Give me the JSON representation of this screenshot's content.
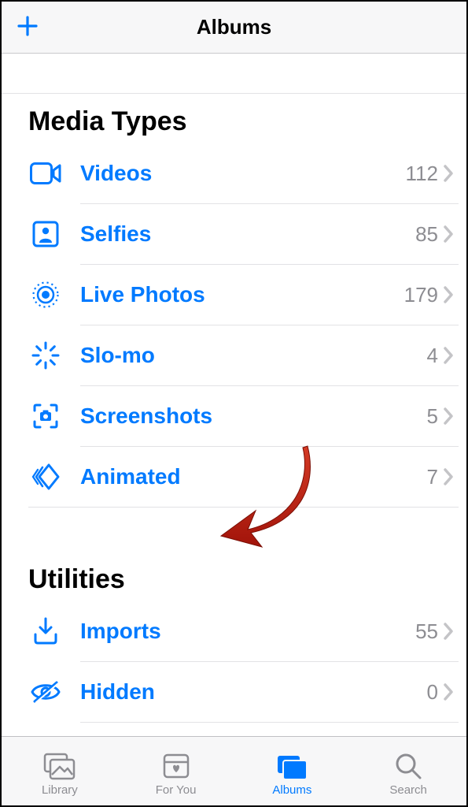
{
  "header": {
    "title": "Albums"
  },
  "sections": {
    "mediaTypes": {
      "title": "Media Types",
      "items": [
        {
          "icon": "video",
          "label": "Videos",
          "count": "112"
        },
        {
          "icon": "selfie",
          "label": "Selfies",
          "count": "85"
        },
        {
          "icon": "livephoto",
          "label": "Live Photos",
          "count": "179"
        },
        {
          "icon": "slomo",
          "label": "Slo-mo",
          "count": "4"
        },
        {
          "icon": "screenshot",
          "label": "Screenshots",
          "count": "5"
        },
        {
          "icon": "animated",
          "label": "Animated",
          "count": "7"
        }
      ]
    },
    "utilities": {
      "title": "Utilities",
      "items": [
        {
          "icon": "imports",
          "label": "Imports",
          "count": "55"
        },
        {
          "icon": "hidden",
          "label": "Hidden",
          "count": "0"
        }
      ]
    }
  },
  "tabs": [
    {
      "icon": "library",
      "label": "Library",
      "active": false
    },
    {
      "icon": "foryou",
      "label": "For You",
      "active": false
    },
    {
      "icon": "albums",
      "label": "Albums",
      "active": true
    },
    {
      "icon": "search",
      "label": "Search",
      "active": false
    }
  ]
}
